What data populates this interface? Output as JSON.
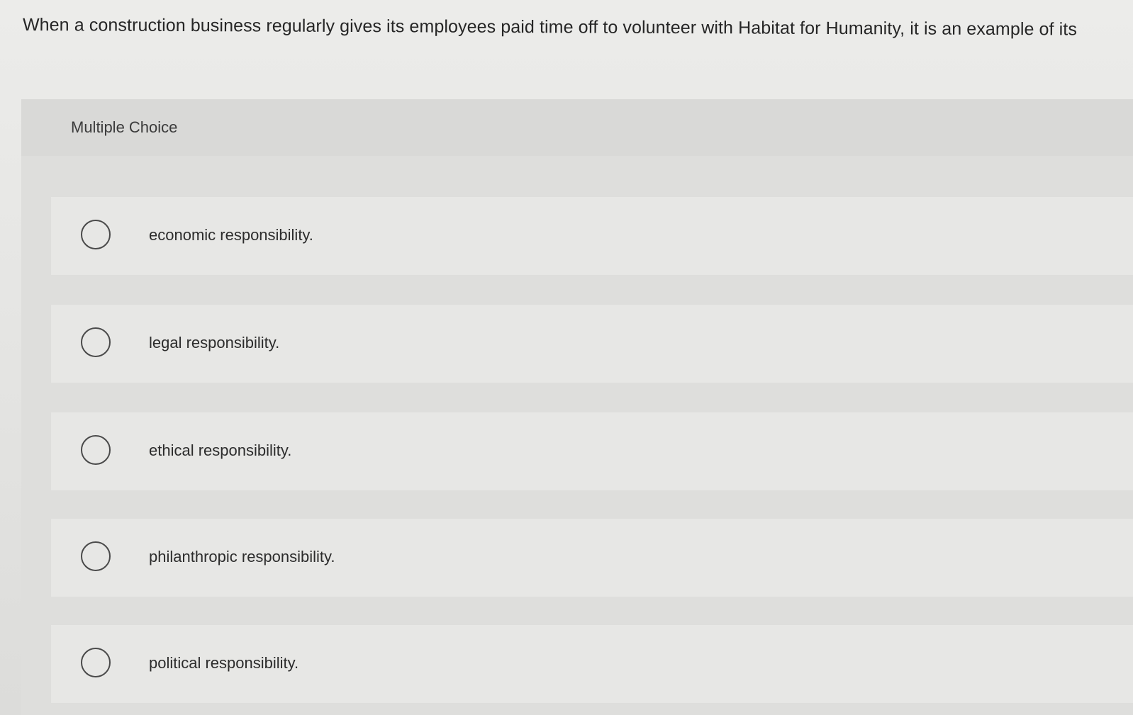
{
  "question": {
    "text": "When a construction business regularly gives its employees paid time off to volunteer with Habitat for Humanity, it is an example of its"
  },
  "multiple_choice": {
    "label": "Multiple Choice",
    "options": [
      {
        "label": "economic responsibility.",
        "selected": false
      },
      {
        "label": "legal responsibility.",
        "selected": false
      },
      {
        "label": "ethical responsibility.",
        "selected": false
      },
      {
        "label": "philanthropic responsibility.",
        "selected": false
      },
      {
        "label": "political responsibility.",
        "selected": false
      }
    ]
  }
}
